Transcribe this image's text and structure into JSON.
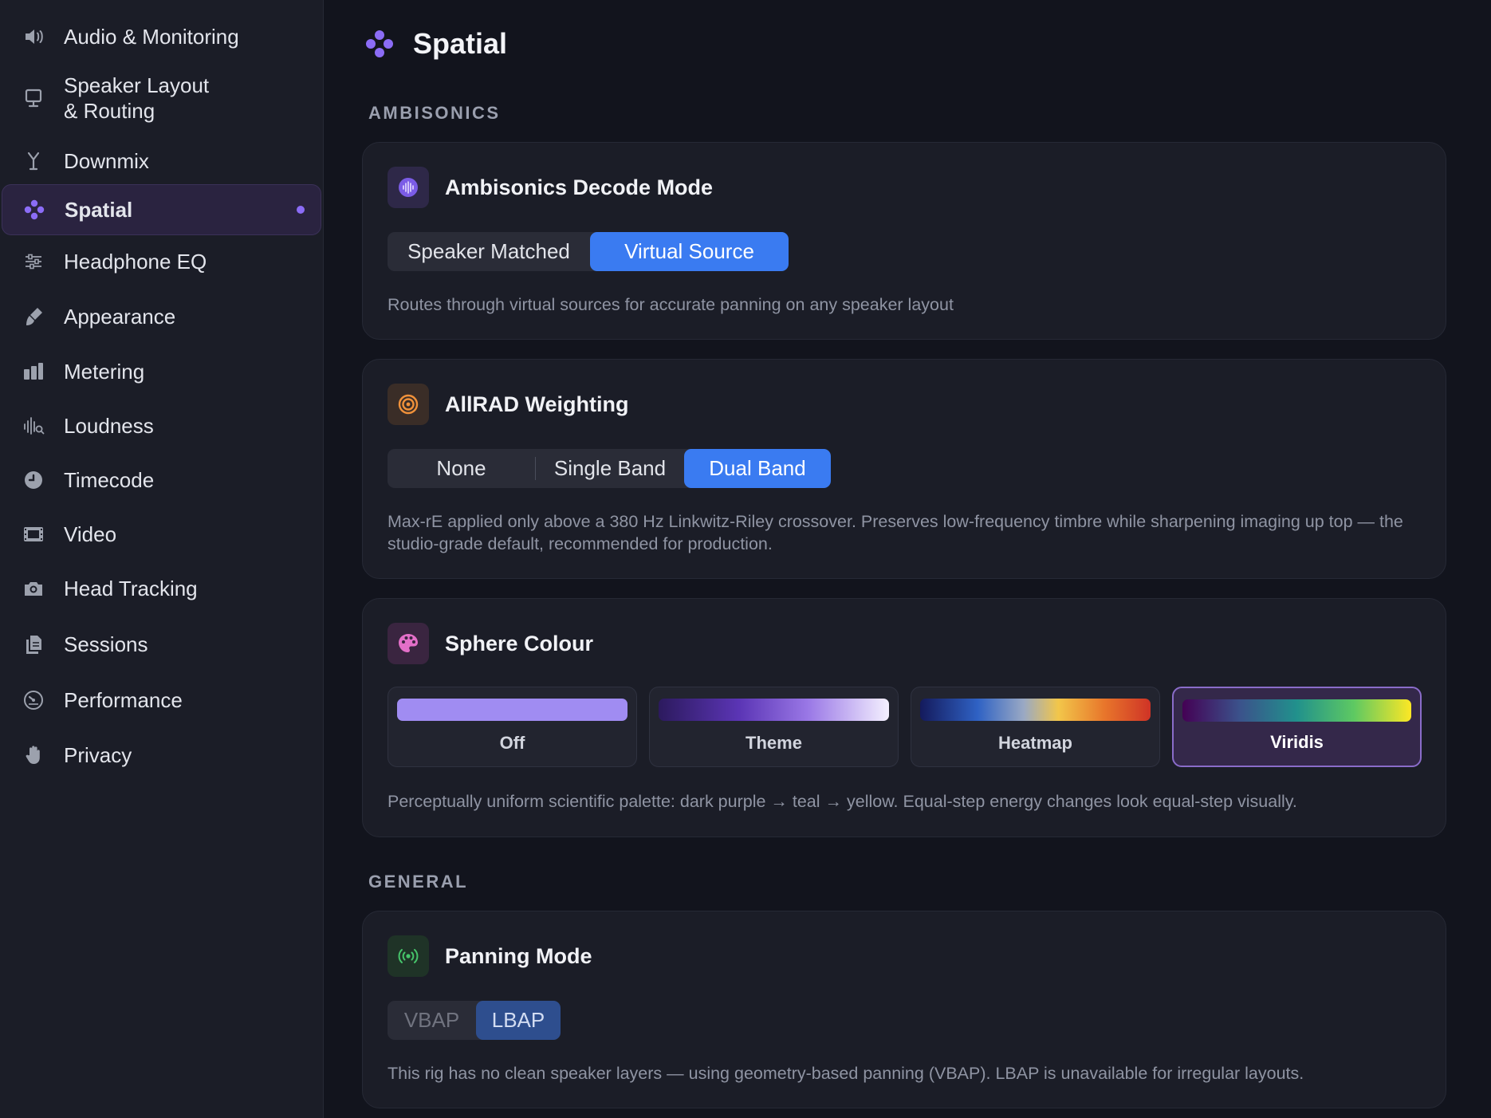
{
  "sidebar": {
    "items": [
      {
        "label": "Audio & Monitoring",
        "icon": "speaker-volume-icon"
      },
      {
        "label": "Speaker Layout & Routing",
        "label_line1": "Speaker Layout",
        "label_line2": "& Routing",
        "icon": "monitor-icon"
      },
      {
        "label": "Downmix",
        "icon": "downmix-icon"
      },
      {
        "label": "Spatial",
        "icon": "spatial-dots-icon",
        "active": true
      },
      {
        "label": "Headphone EQ",
        "icon": "sliders-icon"
      },
      {
        "label": "Appearance",
        "icon": "paintbrush-icon"
      },
      {
        "label": "Metering",
        "icon": "meter-bars-icon"
      },
      {
        "label": "Loudness",
        "icon": "waveform-search-icon"
      },
      {
        "label": "Timecode",
        "icon": "clock-icon"
      },
      {
        "label": "Video",
        "icon": "film-icon"
      },
      {
        "label": "Head Tracking",
        "icon": "camera-icon"
      },
      {
        "label": "Sessions",
        "icon": "documents-icon"
      },
      {
        "label": "Performance",
        "icon": "gauge-icon"
      },
      {
        "label": "Privacy",
        "icon": "hand-icon"
      }
    ]
  },
  "page": {
    "title": "Spatial",
    "icon": "spatial-dots-icon"
  },
  "sections": {
    "ambisonics_label": "AMBISONICS",
    "general_label": "GENERAL"
  },
  "decode_mode": {
    "title": "Ambisonics Decode Mode",
    "icon": "waveform-circle-icon",
    "options": [
      "Speaker Matched",
      "Virtual Source"
    ],
    "selected": "Virtual Source",
    "description": "Routes through virtual sources for accurate panning on any speaker layout"
  },
  "allrad": {
    "title": "AllRAD Weighting",
    "icon": "target-icon",
    "options": [
      "None",
      "Single Band",
      "Dual Band"
    ],
    "selected": "Dual Band",
    "description": "Max-rE applied only above a 380 Hz Linkwitz-Riley crossover. Preserves low-frequency timbre while sharpening imaging up top — the studio-grade default, recommended for production."
  },
  "sphere_colour": {
    "title": "Sphere Colour",
    "icon": "palette-icon",
    "options": [
      "Off",
      "Theme",
      "Heatmap",
      "Viridis"
    ],
    "selected": "Viridis",
    "description": "Perceptually uniform scientific palette: dark purple → teal → yellow. Equal-step energy changes look equal-step visually."
  },
  "panning_mode": {
    "title": "Panning Mode",
    "icon": "broadcast-icon",
    "options": [
      "VBAP",
      "LBAP"
    ],
    "selected": "LBAP",
    "disabled": true,
    "description": "This rig has no clean speaker layers — using geometry-based panning (VBAP). LBAP is unavailable for irregular layouts."
  },
  "colors": {
    "accent": "#3a7bf1",
    "active_nav": "#8b6cf6",
    "background": "#12141d",
    "card": "#1b1d27"
  }
}
